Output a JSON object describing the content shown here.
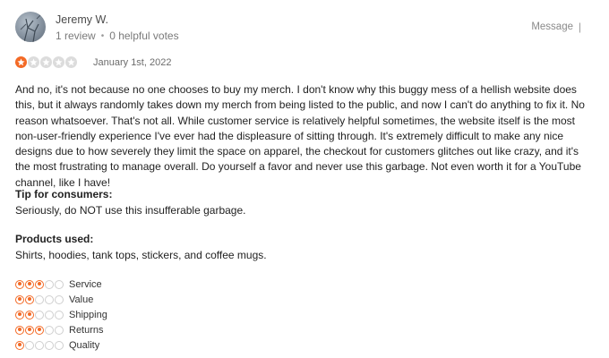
{
  "author": {
    "name": "Jeremy W.",
    "reviews": "1 review",
    "helpful_votes": "0 helpful votes"
  },
  "actions": {
    "message_label": "Message",
    "divider": "|"
  },
  "review": {
    "rating": 1,
    "max_rating": 5,
    "date": "January 1st, 2022",
    "body": "And no, it's not because no one chooses to buy my merch. I don't know why this buggy mess of a hellish website does this, but it always randomly takes down my merch from being listed to the public, and now I can't do anything to fix it. No reason whatsoever. That's not all. While customer service is relatively helpful sometimes, the website itself is the most non-user-friendly experience I've ever had the displeasure of sitting through. It's extremely difficult to make any nice designs due to how severely they limit the space on apparel, the checkout for customers glitches out like crazy, and it's the most frustrating to manage overall. Do yourself a favor and never use this garbage. Not even worth it for a YouTube channel, like I have!",
    "tip_label": "Tip for consumers:",
    "tip_text": "Seriously, do NOT use this insufferable garbage.",
    "products_label": "Products used:",
    "products_text": "Shirts, hoodies, tank tops, stickers, and coffee mugs."
  },
  "sub_ratings": [
    {
      "label": "Service",
      "value": 3,
      "max": 5
    },
    {
      "label": "Value",
      "value": 2,
      "max": 5
    },
    {
      "label": "Shipping",
      "value": 2,
      "max": 5
    },
    {
      "label": "Returns",
      "value": 3,
      "max": 5
    },
    {
      "label": "Quality",
      "value": 1,
      "max": 5
    }
  ],
  "colors": {
    "accent": "#f36a26",
    "inactive": "#dcdcdc"
  }
}
